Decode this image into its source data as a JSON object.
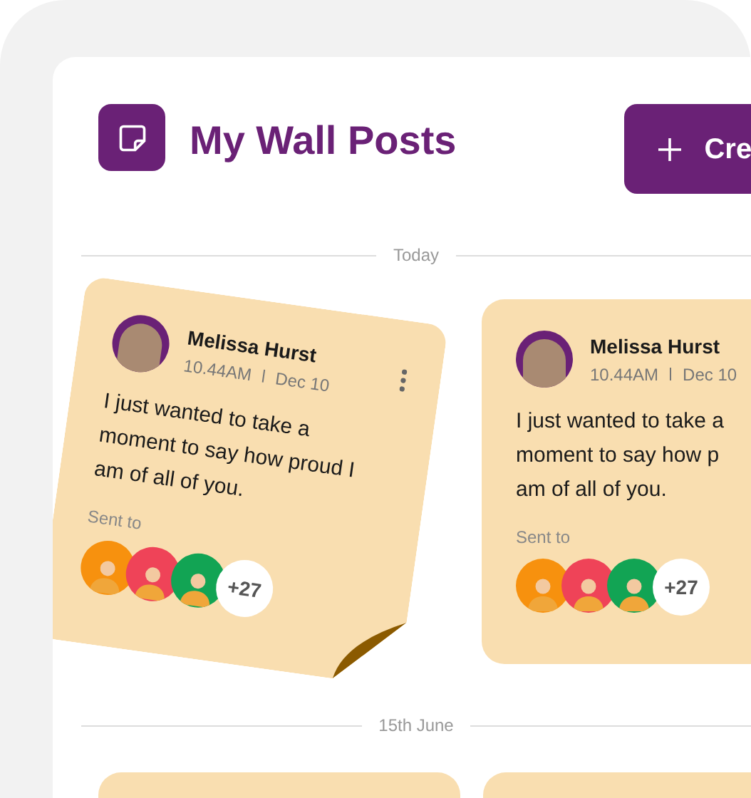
{
  "header": {
    "title": "My Wall Posts",
    "create_button": "Cre"
  },
  "sections": [
    {
      "label": "Today",
      "posts": [
        {
          "kind": "tilted",
          "has_menu": true,
          "author": "Melissa Hurst",
          "time": "10.44AM",
          "date": "Dec 10",
          "text_lines": [
            "I just wanted to take a",
            "moment to say how proud I",
            "am of all of you."
          ],
          "sent_to_label": "Sent to",
          "recipients": [
            {
              "color": "#f7910e"
            },
            {
              "color": "#ef4358"
            },
            {
              "color": "#12a454"
            }
          ],
          "more": "+27"
        },
        {
          "kind": "flat",
          "author": "Melissa Hurst",
          "time": "10.44AM",
          "date": "Dec 10",
          "text_lines": [
            "I just wanted to take a",
            "moment to say how p",
            "am of all of you."
          ],
          "sent_to_label": "Sent to",
          "recipients": [
            {
              "color": "#f7910e"
            },
            {
              "color": "#ef4358"
            },
            {
              "color": "#12a454"
            }
          ],
          "more": "+27"
        }
      ]
    },
    {
      "label": "15th June"
    }
  ]
}
